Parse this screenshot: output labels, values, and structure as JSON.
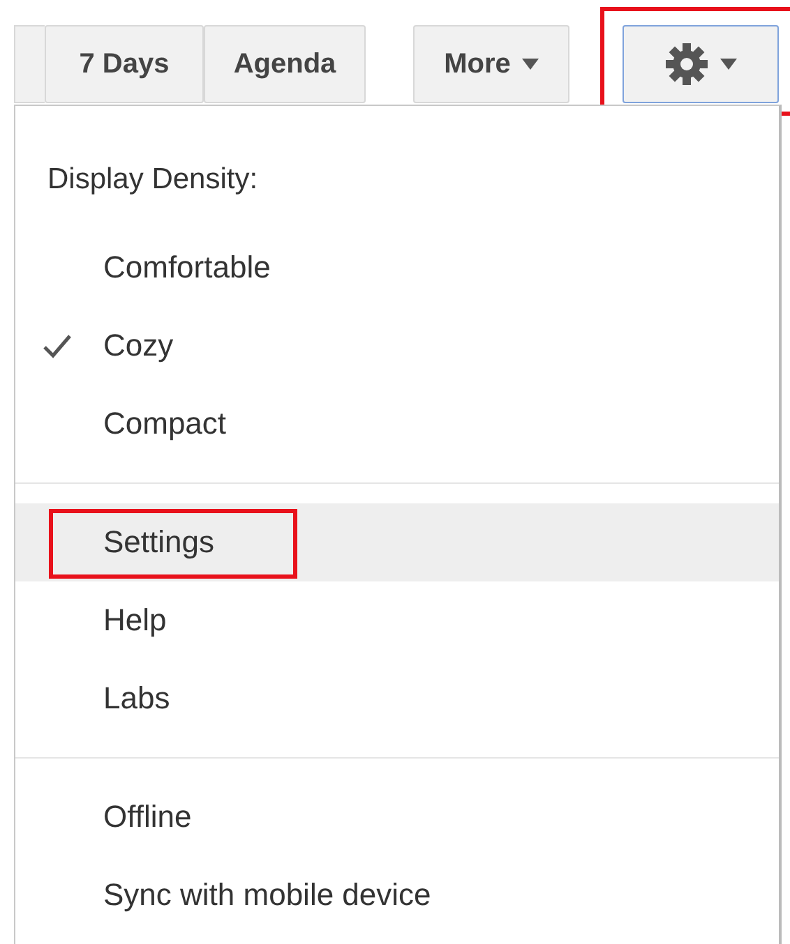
{
  "toolbar": {
    "buttons": [
      {
        "kind": "view",
        "label": "7 Days"
      },
      {
        "kind": "view",
        "label": "Agenda"
      },
      {
        "kind": "dropdown",
        "label": "More"
      },
      {
        "kind": "settings",
        "highlighted": true
      }
    ]
  },
  "menu": {
    "heading": "Display Density:",
    "sections": [
      {
        "items": [
          {
            "label": "Comfortable",
            "checked": false,
            "selected": false,
            "highlighted": false
          },
          {
            "label": "Cozy",
            "checked": true,
            "selected": false,
            "highlighted": false
          },
          {
            "label": "Compact",
            "checked": false,
            "selected": false,
            "highlighted": false
          }
        ]
      },
      {
        "items": [
          {
            "label": "Settings",
            "checked": false,
            "selected": true,
            "highlighted": true
          },
          {
            "label": "Help",
            "checked": false,
            "selected": false,
            "highlighted": false
          },
          {
            "label": "Labs",
            "checked": false,
            "selected": false,
            "highlighted": false
          }
        ]
      },
      {
        "items": [
          {
            "label": "Offline",
            "checked": false,
            "selected": false,
            "highlighted": false
          },
          {
            "label": "Sync with mobile device",
            "checked": false,
            "selected": false,
            "highlighted": false
          }
        ]
      }
    ]
  }
}
